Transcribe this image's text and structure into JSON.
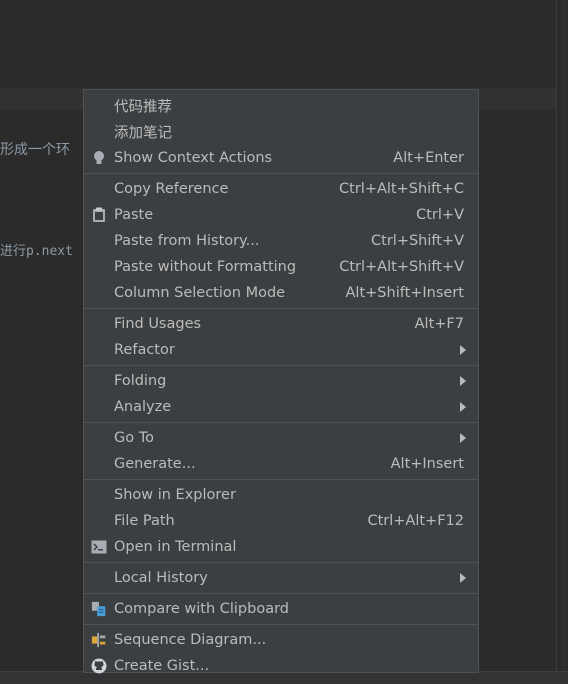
{
  "editor": {
    "code_line_1": "形成一个环",
    "code_line_2": "进行p.next"
  },
  "context_menu": {
    "groups": [
      [
        {
          "label": "代码推荐",
          "shortcut": "",
          "icon": "",
          "submenu": false
        },
        {
          "label": "添加笔记",
          "shortcut": "",
          "icon": "",
          "submenu": false
        },
        {
          "label": "Show Context Actions",
          "shortcut": "Alt+Enter",
          "icon": "lightbulb-icon",
          "submenu": false
        }
      ],
      [
        {
          "label": "Copy Reference",
          "shortcut": "Ctrl+Alt+Shift+C",
          "icon": "",
          "submenu": false
        },
        {
          "label": "Paste",
          "shortcut": "Ctrl+V",
          "icon": "clipboard-icon",
          "submenu": false
        },
        {
          "label": "Paste from History...",
          "shortcut": "Ctrl+Shift+V",
          "icon": "",
          "submenu": false
        },
        {
          "label": "Paste without Formatting",
          "shortcut": "Ctrl+Alt+Shift+V",
          "icon": "",
          "submenu": false
        },
        {
          "label": "Column Selection Mode",
          "shortcut": "Alt+Shift+Insert",
          "icon": "",
          "submenu": false
        }
      ],
      [
        {
          "label": "Find Usages",
          "shortcut": "Alt+F7",
          "icon": "",
          "submenu": false
        },
        {
          "label": "Refactor",
          "shortcut": "",
          "icon": "",
          "submenu": true
        }
      ],
      [
        {
          "label": "Folding",
          "shortcut": "",
          "icon": "",
          "submenu": true
        },
        {
          "label": "Analyze",
          "shortcut": "",
          "icon": "",
          "submenu": true
        }
      ],
      [
        {
          "label": "Go To",
          "shortcut": "",
          "icon": "",
          "submenu": true
        },
        {
          "label": "Generate...",
          "shortcut": "Alt+Insert",
          "icon": "",
          "submenu": false
        }
      ],
      [
        {
          "label": "Show in Explorer",
          "shortcut": "",
          "icon": "",
          "submenu": false
        },
        {
          "label": "File Path",
          "shortcut": "Ctrl+Alt+F12",
          "icon": "",
          "submenu": false
        },
        {
          "label": "Open in Terminal",
          "shortcut": "",
          "icon": "terminal-icon",
          "submenu": false
        }
      ],
      [
        {
          "label": "Local History",
          "shortcut": "",
          "icon": "",
          "submenu": true
        }
      ],
      [
        {
          "label": "Compare with Clipboard",
          "shortcut": "",
          "icon": "compare-icon",
          "submenu": false
        }
      ],
      [
        {
          "label": "Sequence Diagram...",
          "shortcut": "",
          "icon": "sequence-diagram-icon",
          "submenu": false
        },
        {
          "label": "Create Gist...",
          "shortcut": "",
          "icon": "github-icon",
          "submenu": false
        }
      ]
    ]
  }
}
